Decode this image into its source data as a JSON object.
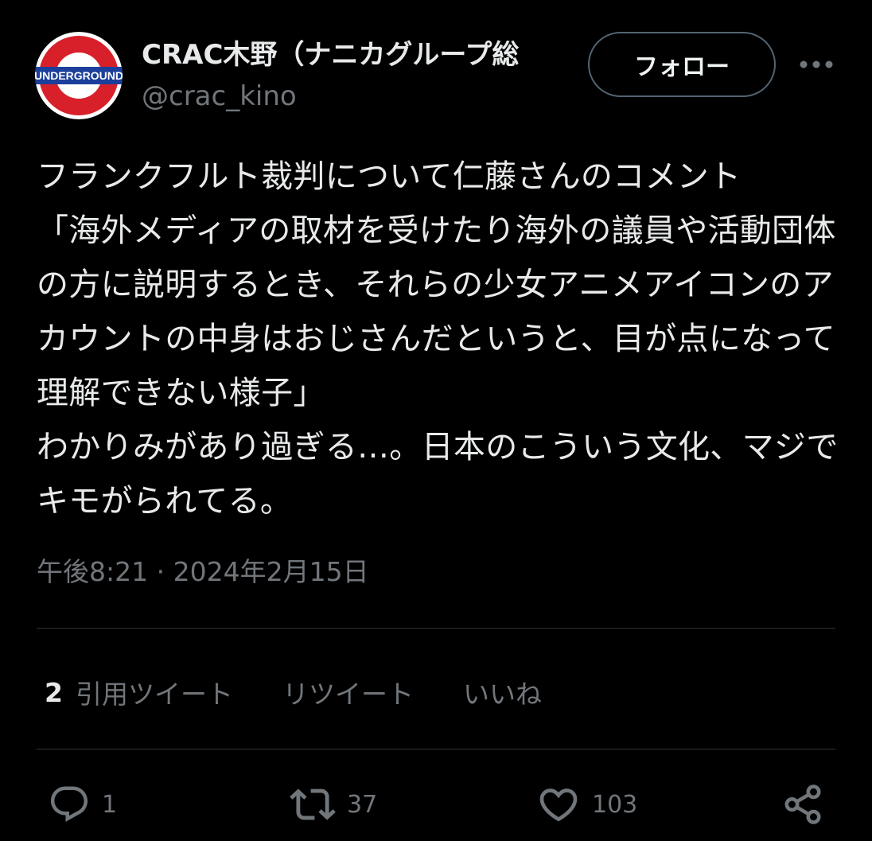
{
  "user": {
    "display_name": "CRAC木野（ナニカグループ総",
    "handle": "@crac_kino",
    "avatar_text": "UNDERGROUND"
  },
  "header": {
    "follow_label": "フォロー",
    "more_icon": "more-horizontal-icon"
  },
  "tweet": {
    "text": "フランクフルト裁判について仁藤さんのコメント\n「海外メディアの取材を受けたり海外の議員や活動団体の方に説明するとき、それらの少女アニメアイコンのアカウントの中身はおじさんだというと、目が点になって理解できない様子」\nわかりみがあり過ぎる…。日本のこういう文化、マジでキモがられてる。",
    "time": "午後8:21",
    "separator": "·",
    "date": "2024年2月15日"
  },
  "stats": {
    "quote_count": "2",
    "quote_label": "引用ツイート",
    "retweet_label": "リツイート",
    "like_label": "いいね"
  },
  "actions": {
    "reply": {
      "icon": "reply-icon",
      "count": "1"
    },
    "retweet": {
      "icon": "retweet-icon",
      "count": "37"
    },
    "like": {
      "icon": "heart-icon",
      "count": "103"
    },
    "share": {
      "icon": "share-icon"
    }
  },
  "colors": {
    "background": "#000000",
    "text_primary": "#e7e9ea",
    "text_secondary": "#71767b",
    "divider": "#2f3336",
    "avatar_ring": "#d8202a",
    "avatar_bar": "#1b3f9a"
  }
}
